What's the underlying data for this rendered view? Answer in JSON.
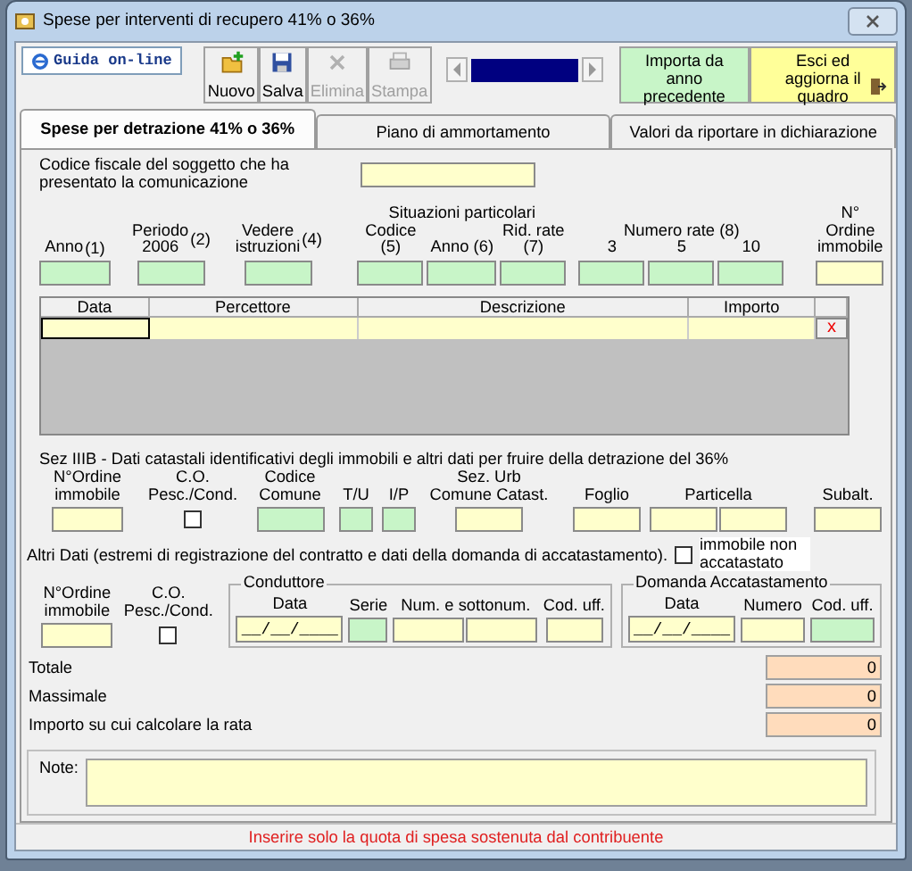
{
  "window": {
    "title": "Spese per interventi di recupero 41% o 36%"
  },
  "toolbar": {
    "help_button": {
      "label": "Guida on-line"
    },
    "buttons": [
      {
        "label": "Nuovo",
        "kind": "new",
        "disabled": false
      },
      {
        "label": "Salva",
        "kind": "save",
        "disabled": false
      },
      {
        "label": "Elimina",
        "kind": "delete",
        "disabled": true
      },
      {
        "label": "Stampa",
        "kind": "print",
        "disabled": true
      }
    ],
    "import_button": {
      "label": "Importa da anno precedente"
    },
    "exit_button": {
      "label": "Esci ed aggiorna il quadro"
    }
  },
  "tabs": [
    {
      "label": "Spese per detrazione 41% o 36%",
      "selected": true
    },
    {
      "label": "Piano di ammortamento",
      "selected": false
    },
    {
      "label": "Valori da riportare in dichiarazione",
      "selected": false
    }
  ],
  "codice_fiscale": {
    "label": "Codice fiscale del soggetto che ha presentato la comunicazione"
  },
  "main_fields": [
    {
      "fields": [
        {
          "label": "Anno",
          "note": "(1)",
          "color": "#c8f5c8"
        }
      ]
    },
    {
      "fields": [
        {
          "label": "Periodo 2006",
          "note": "(2)",
          "color": "#c8f5c8"
        }
      ]
    },
    {
      "fields": [
        {
          "label": "Vedere istruzioni",
          "note": "(4)",
          "color": "#c8f5c8"
        }
      ]
    },
    {
      "title": "Situazioni particolari",
      "fields": [
        {
          "label": "Codice (5)",
          "color": "#c8f5c8"
        },
        {
          "label": "Anno (6)",
          "color": "#c8f5c8"
        },
        {
          "label": "Rid. rate (7)",
          "color": "#c8f5c8"
        }
      ]
    },
    {
      "title": "Numero rate (8)",
      "fields": [
        {
          "label": "3",
          "color": "#c8f5c8"
        },
        {
          "label": "5",
          "color": "#c8f5c8"
        },
        {
          "label": "10",
          "color": "#c8f5c8"
        }
      ]
    },
    {
      "fields": [
        {
          "label": "N° Ordine immobile",
          "color": "#ffffcc"
        }
      ]
    }
  ],
  "expenses_table": {
    "columns": [
      "Data",
      "Percettore",
      "Descrizione",
      "Importo"
    ],
    "rows": [
      {
        "delete_label": "x"
      }
    ]
  },
  "sez_iiib": {
    "title": "Sez IIIB - Dati catastali identificativi degli immobili e altri dati per fruire della detrazione del 36%",
    "fields": [
      {
        "label": "N°Ordine immobile",
        "kind": "input",
        "color": "#ffffcc"
      },
      {
        "label": "C.O. Pesc./Cond.",
        "kind": "checkbox",
        "checked": false
      },
      {
        "label": "Codice Comune",
        "kind": "input",
        "color": "#c8f5c8"
      },
      {
        "label": "T/U",
        "kind": "input",
        "color": "#c8f5c8"
      },
      {
        "label": "I/P",
        "kind": "input",
        "color": "#c8f5c8"
      },
      {
        "label": "Sez. Urb Comune Catast.",
        "kind": "input",
        "color": "#ffffcc"
      },
      {
        "label": "Foglio",
        "kind": "input",
        "color": "#ffffcc"
      },
      {
        "label": "Particella",
        "kind": "double",
        "color": "#ffffcc"
      },
      {
        "label": "Subalt.",
        "kind": "input",
        "color": "#ffffcc"
      }
    ]
  },
  "altri_dati": {
    "text": "Altri Dati (estremi di registrazione del contratto e dati della domanda di accatastamento).",
    "checkbox": {
      "label": "immobile non accatastato",
      "checked": false
    }
  },
  "altri_fields": [
    {
      "label": "N°Ordine immobile",
      "kind": "input",
      "color": "#ffffcc"
    },
    {
      "label": "C.O. Pesc./Cond.",
      "kind": "checkbox",
      "checked": false
    }
  ],
  "conduttore": {
    "title": "Conduttore",
    "fields": [
      {
        "label": "Data",
        "kind": "date",
        "value": "__/__/____"
      },
      {
        "label": "Serie",
        "kind": "input",
        "color": "#c8f5c8"
      },
      {
        "label": "Num. e sottonum.",
        "kind": "double",
        "color": "#ffffcc"
      },
      {
        "label": "Cod. uff.",
        "kind": "input",
        "color": "#ffffcc"
      }
    ]
  },
  "domanda": {
    "title": "Domanda Accatastamento",
    "fields": [
      {
        "label": "Data",
        "kind": "date",
        "value": "__/__/____"
      },
      {
        "label": "Numero",
        "kind": "input",
        "color": "#ffffcc"
      },
      {
        "label": "Cod. uff.",
        "kind": "input",
        "color": "#c8f5c8"
      }
    ]
  },
  "totals": [
    {
      "label": "Totale",
      "value": "0"
    },
    {
      "label": "Massimale",
      "value": "0"
    },
    {
      "label": "Importo su cui calcolare la rata",
      "value": "0"
    }
  ],
  "note": {
    "label": "Note:"
  },
  "status_message": "Inserire solo la quota di spesa sostenuta dal contribuente"
}
